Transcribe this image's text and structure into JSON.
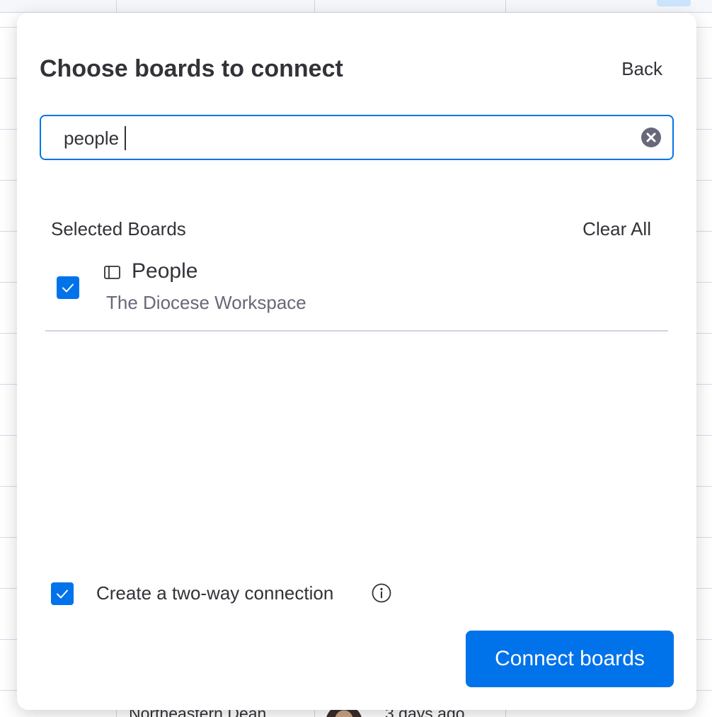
{
  "modal": {
    "title": "Choose boards to connect",
    "back_label": "Back",
    "search": {
      "value": "people",
      "placeholder": ""
    },
    "selected_section": {
      "label": "Selected Boards",
      "clear_all_label": "Clear All",
      "boards": [
        {
          "name": "People",
          "workspace": "The Diocese Workspace",
          "checked": true,
          "icon": "board-icon"
        }
      ]
    },
    "two_way": {
      "label": "Create a two-way connection",
      "checked": true,
      "icon": "info-icon"
    },
    "connect_button_label": "Connect boards"
  },
  "background": {
    "row_name": "Northeastern Dean",
    "row_time": "3 days ago"
  },
  "colors": {
    "accent": "#0073ea",
    "text": "#323338",
    "secondary_text": "#676879"
  }
}
